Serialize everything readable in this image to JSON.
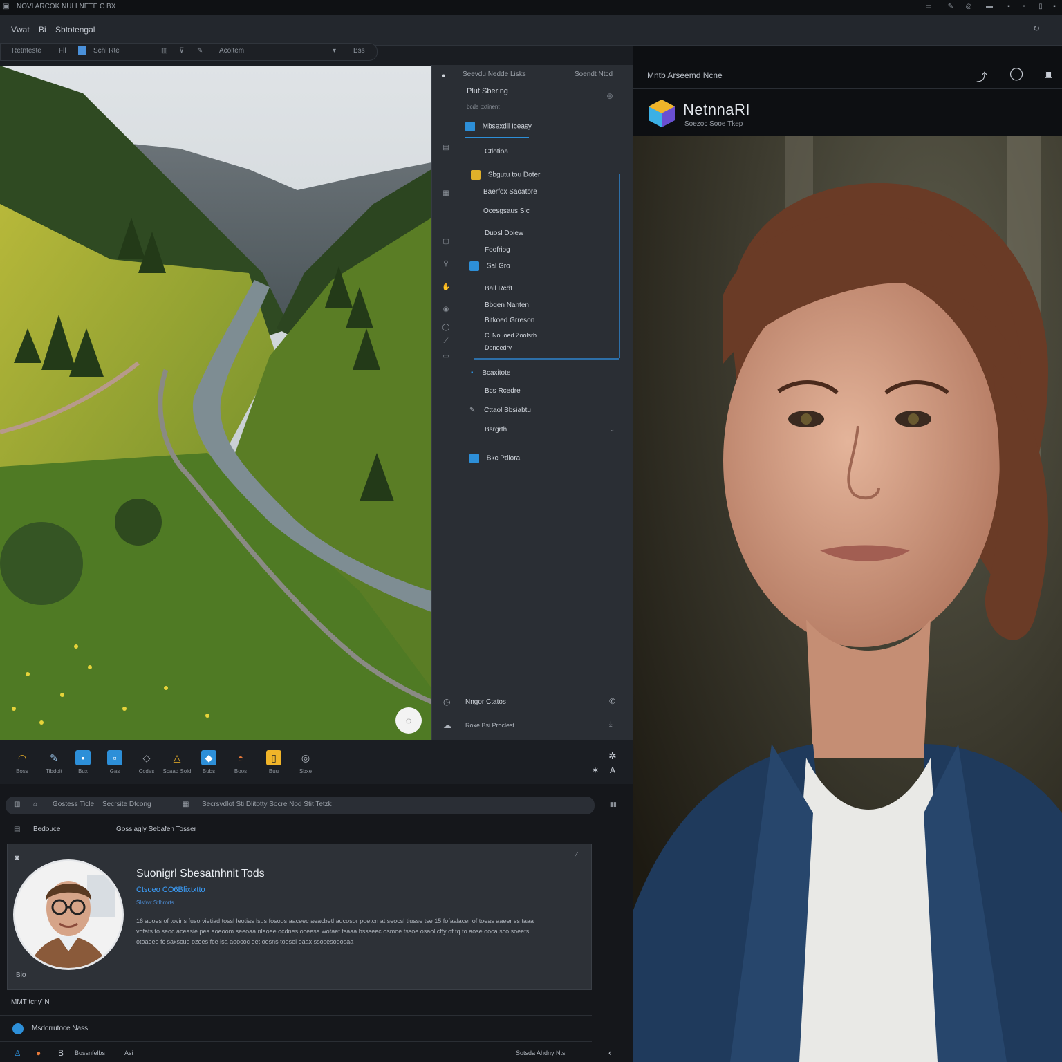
{
  "titlebar": {
    "app_name": "NOVI ARCOK NULLNETE C BX"
  },
  "menubar": {
    "items": [
      "Vwat",
      "Bi",
      "Sbtotengal"
    ]
  },
  "toolbar": {
    "items": [
      "Retnteste",
      "Fll",
      "Schl Rte",
      "Acoitem",
      "Bss"
    ]
  },
  "layers": {
    "header": "Seevdu Nedde Lisks",
    "header_right": "Soendt Ntcd",
    "section_title": "Plut Sbering",
    "section_sub": "bcde pxtinent",
    "selected": "Mbsexdll Iceasy",
    "items": [
      {
        "label": "Ctlotioa"
      },
      {
        "label": "Sbgutu tou Doter"
      },
      {
        "label": "Baerfox Saoatore"
      },
      {
        "label": "Ocesgsaus Sic"
      },
      {
        "label": "Duosl Doiew"
      },
      {
        "label": "Foofriog"
      },
      {
        "label": "Sal Gro"
      },
      {
        "label": "Ball Rcdt"
      },
      {
        "label": "Bbgen Nanten"
      },
      {
        "label": "Bitkoed Grreson"
      },
      {
        "label": "Ci Nouoed Zoolsrb"
      },
      {
        "label": "Dpnoedry"
      },
      {
        "label": "Bcaxitote"
      },
      {
        "label": "Bcs Rcedre"
      },
      {
        "label": "Cttaol Bbsiabtu"
      },
      {
        "label": "Bsrgrth"
      },
      {
        "label": "Bkc Pdiora"
      }
    ],
    "footer1": "Nngor Ctatos",
    "footer2": "Roxe Bsi Proclest"
  },
  "right": {
    "title": "Mntb Arseemd Ncne",
    "logo_name": "NetnnaRI",
    "logo_sub": "Soezoc Sooe Tkep"
  },
  "tools": [
    "Boss",
    "Tibdoit",
    "Bux",
    "Gas",
    "Ccdes",
    "Scaad Sold",
    "Bubs",
    "Boos",
    "Buu",
    "Sbxe"
  ],
  "lower": {
    "search_left": "Gostess Ticle",
    "search_mid": "Secrsite Dtcong",
    "search_right": "Secrsvdlot Sti Dlitotty Socre Nod Stit Tetzk",
    "tab_left": "Bedouce",
    "tab_right": "Gossiagly Sebafeh Tosser",
    "card": {
      "name": "Suonigrl Sbesatnhnit Tods",
      "role": "Ctsoeo CO6Bfixtxtto",
      "sub": "Slsfrvr Stlhrorts",
      "body": "16 aooes of tovins fuso vietiad tossl leotias lsus fosoos aaceec aeacbetl adcosor poetcn at seocsl tiusse tse 15 fofaalacer of toeas aaeer ss taaa vofats to seoc aceasie pes aoeoom seeoaa nlaoee ocdnes oceesa wotaet tsaaa bssseec osmoe tssoe osaol cffy of tq to aose ooca sco soeets otoaoeo fc saxscuo ozoes fce lsa aoococ eet oesns toesel oaax ssosesooosaa",
      "footer": "Bio"
    },
    "label_mid": "MMT tcny' N",
    "list_item": "Msdorrutoce Nass",
    "status_left": "Bossnfelbs",
    "status_mid": "Asi",
    "status_right": "Sotsda Ahdny Nts"
  }
}
